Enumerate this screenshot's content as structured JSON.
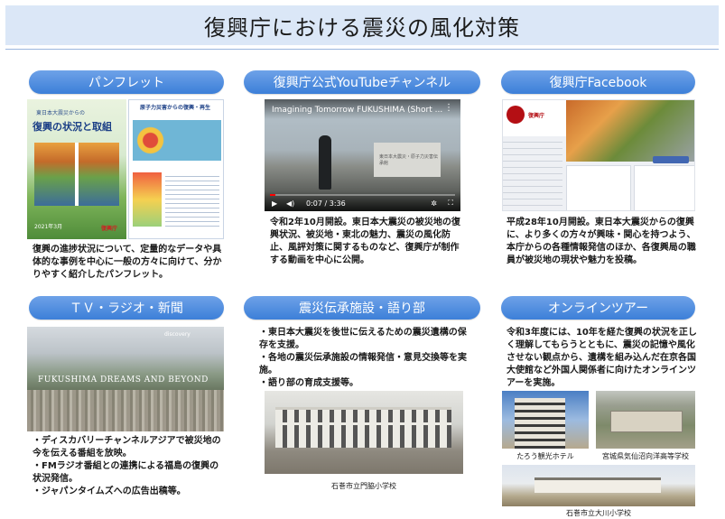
{
  "title": "復興庁における震災の風化対策",
  "sections": {
    "pamphlet": {
      "label": "パンフレット",
      "cover_kicker": "東日本大震災からの",
      "cover_title": "復興の状況と取組",
      "cover_date": "2021年3月",
      "cover_logo": "復興庁",
      "page_heading": "原子力災害からの復興・再生",
      "description": "復興の進捗状況について、定量的なデータや具体的な事例を中心に一般の方々に向けて、分かりやすく紹介したパンフレット。"
    },
    "youtube": {
      "label": "復興庁公式YouTubeチャンネル",
      "video_title": "Imagining Tomorrow FUKUSHIMA (Short ...",
      "time": "0:07 / 3:36",
      "progress": 0.03,
      "description": "令和2年10月開設。東日本大震災の被災地の復興状況、被災地・東北の魅力、震災の風化防止、風評対策に関するものなど、復興庁が制作する動画を中心に公開。"
    },
    "facebook": {
      "label": "復興庁Facebook",
      "page_name": "復興庁",
      "description": "平成28年10月開設。東日本大震災からの復興に、より多くの方々が興味・関心を持つよう、本庁からの各種情報発信のほか、各復興局の職員が被災地の現状や魅力を投稿。"
    },
    "tv": {
      "label": "ＴＶ・ラジオ・新聞",
      "channel": "discovery",
      "overlay": "FUKUSHIMA DREAMS AND BEYOND",
      "bullets": [
        "・ディスカバリーチャンネルアジアで被災地の今を伝える番組を放映。",
        "・FMラジオ番組との連携による福島の復興の状況発信。",
        "・ジャパンタイムズへの広告出稿等。"
      ]
    },
    "facility": {
      "label": "震災伝承施設・語り部",
      "bullets": [
        "・東日本大震災を後世に伝えるための震災遺構の保存を支援。",
        "・各地の震災伝承施設の情報発信・意見交換等を実施。",
        "・語り部の育成支援等。"
      ],
      "caption": "石巻市立門脇小学校"
    },
    "tour": {
      "label": "オンラインツアー",
      "description": "令和3年度には、10年を経た復興の状況を正しく理解してもらうとともに、震災の記憶や風化させない観点から、遺構を組み込んだ在京各国大使館など外国人関係者に向けたオンラインツアーを実施。",
      "captions": [
        "たろう観光ホテル",
        "宮城県気仙沼向洋高等学校",
        "石巻市立大川小学校"
      ]
    }
  },
  "colors": {
    "pill": "#3c7fd8",
    "title_bg": "#dbe7f7"
  }
}
